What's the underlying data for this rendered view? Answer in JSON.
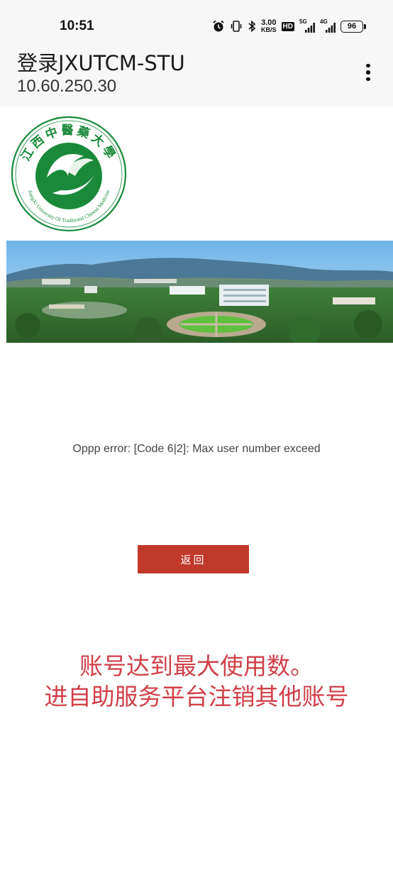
{
  "status_bar": {
    "time": "10:51",
    "speed_value": "3.00",
    "speed_unit": "KB/S",
    "hd_label": "HD",
    "network_1": "5G",
    "network_2": "4G",
    "battery": "96"
  },
  "app_bar": {
    "title": "登录JXUTCM-STU",
    "subtitle": "10.60.250.30"
  },
  "logo": {
    "arc_text": "江西中醫藥大學",
    "english_text": "JiangXi University Of Traditional Chinese Medicine",
    "accent_color": "#1a8a3a"
  },
  "error": {
    "message": "Oppp error: [Code 6|2]: Max user number exceed"
  },
  "back_button": {
    "label": "返回",
    "color": "#c0392b"
  },
  "notice": {
    "line1": "账号达到最大使用数。",
    "line2": "进自助服务平台注销其他账号",
    "color": "#d13f47"
  }
}
